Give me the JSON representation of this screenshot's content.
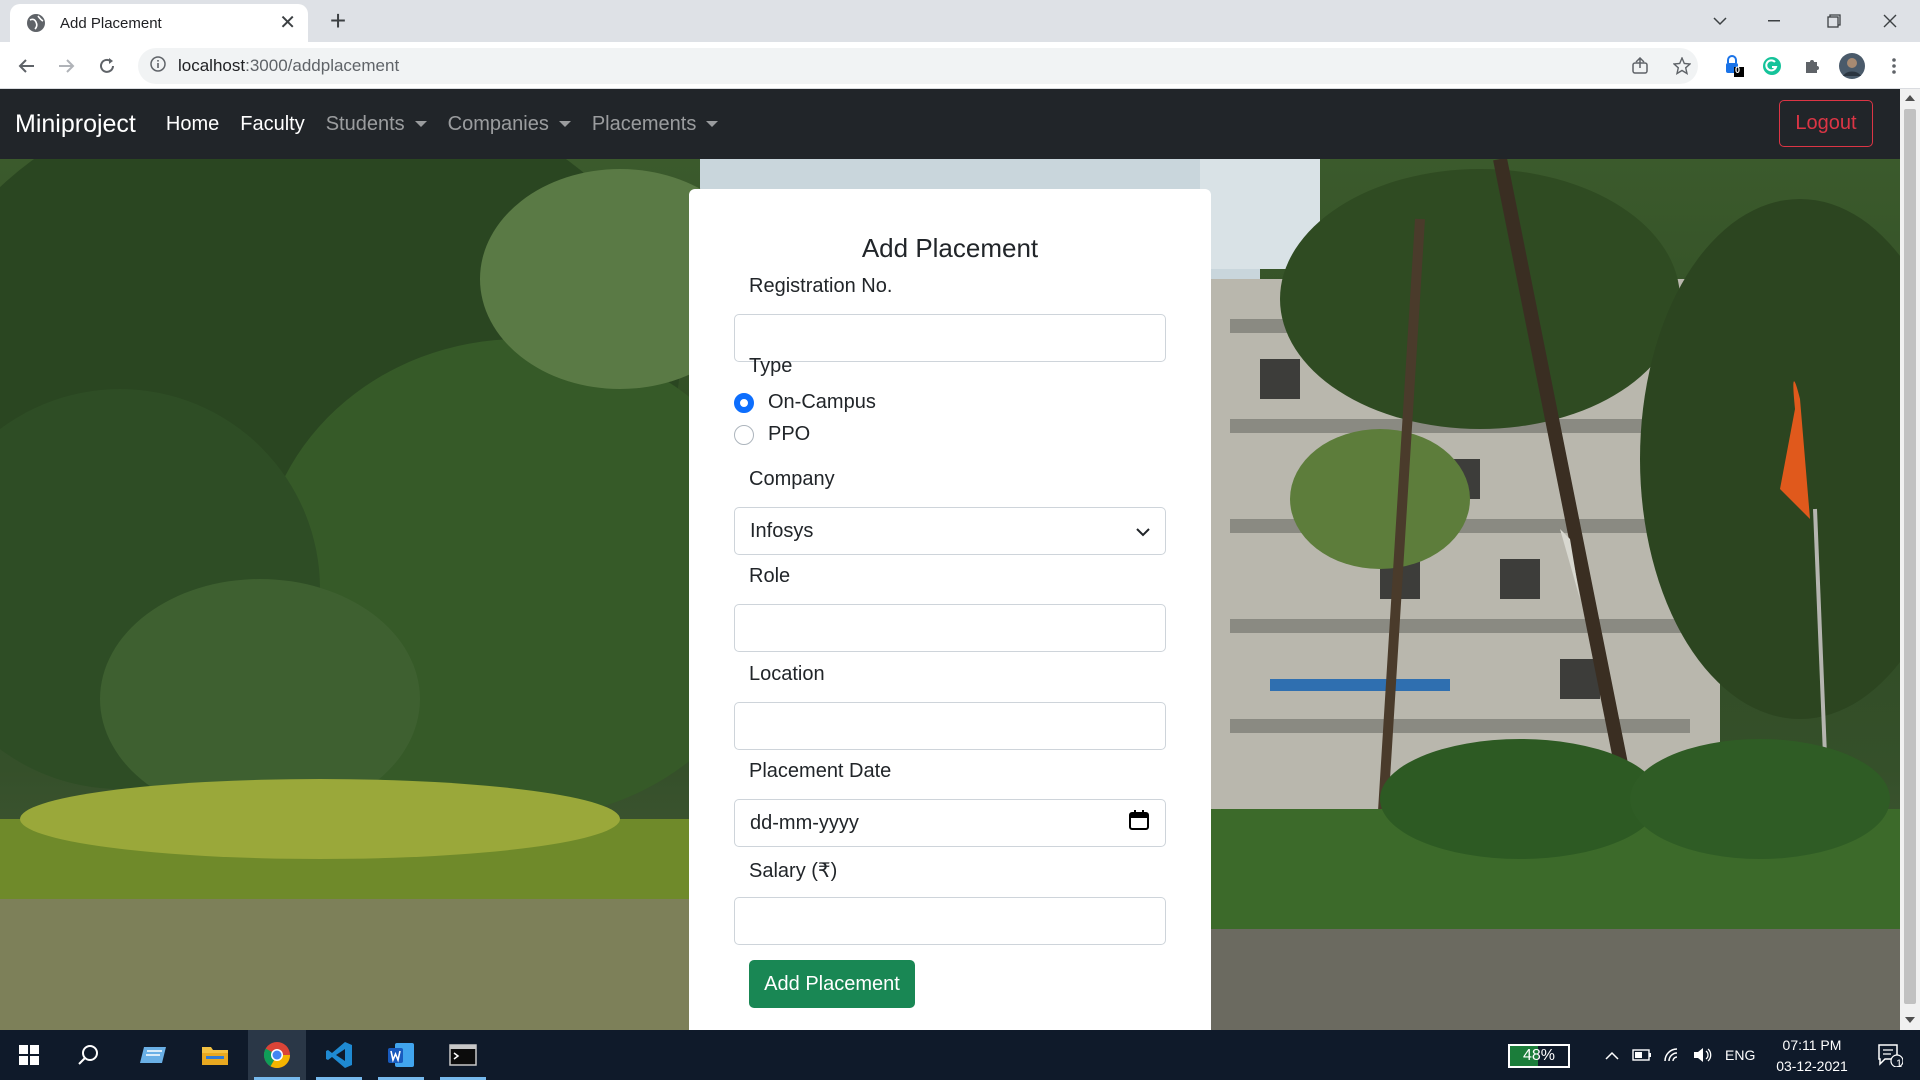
{
  "browser": {
    "tab_title": "Add Placement",
    "url_host": "localhost",
    "url_path": ":3000/addplacement",
    "extension_badge": "0"
  },
  "navbar": {
    "brand": "Miniproject",
    "links": [
      "Home",
      "Faculty",
      "Students",
      "Companies",
      "Placements"
    ],
    "logout_label": "Logout"
  },
  "form": {
    "title": "Add Placement",
    "registration_label": "Registration No.",
    "registration_value": "",
    "type_label": "Type",
    "type_options": [
      "On-Campus",
      "PPO"
    ],
    "type_selected": "On-Campus",
    "company_label": "Company",
    "company_value": "Infosys",
    "role_label": "Role",
    "role_value": "",
    "location_label": "Location",
    "location_value": "",
    "date_label": "Placement Date",
    "date_placeholder": "dd-mm-yyyy",
    "salary_label": "Salary (₹)",
    "salary_value": "",
    "submit_label": "Add Placement"
  },
  "taskbar": {
    "battery": "48%",
    "language": "ENG",
    "time": "07:11 PM",
    "date": "03-12-2021",
    "notifications": "1"
  },
  "colors": {
    "navbar_bg": "#212529",
    "logout": "#dc3545",
    "primary": "#0d6efd",
    "success": "#198754"
  }
}
